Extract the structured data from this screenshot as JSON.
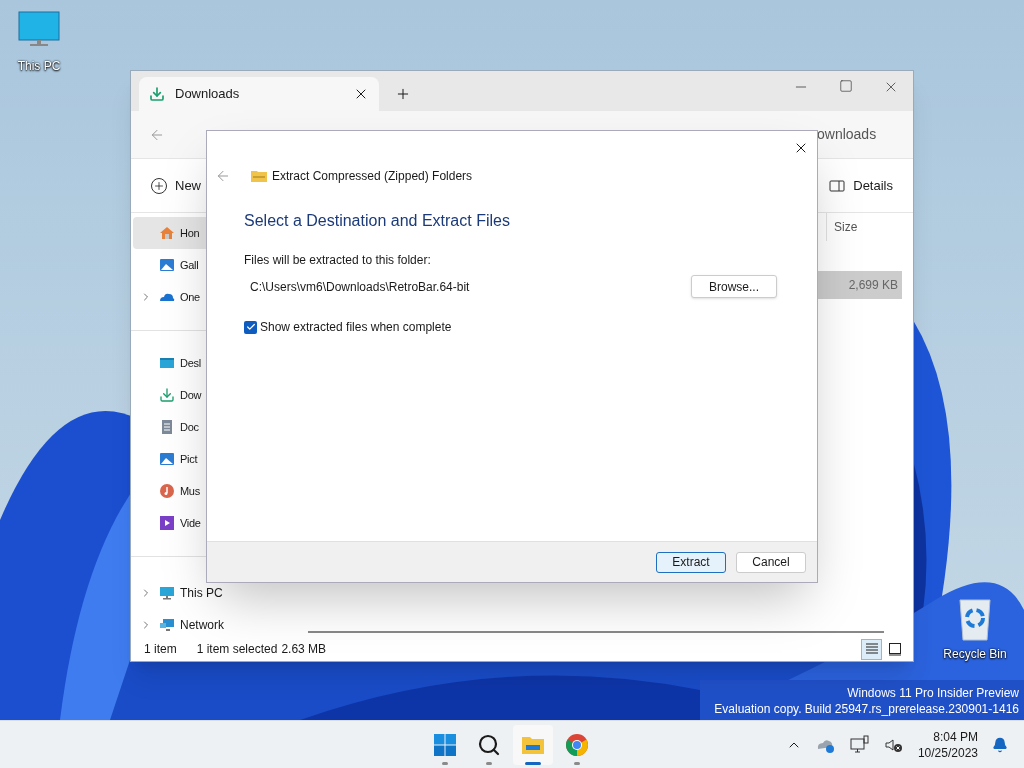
{
  "desktop_icons": [
    {
      "kind": "pc",
      "label": "This PC"
    },
    {
      "kind": "bin",
      "label": "Recycle Bin"
    }
  ],
  "explorer": {
    "tab": {
      "label": "Downloads",
      "selected": true
    },
    "search_field": {
      "placeholder": "ownloads"
    },
    "command_bar": {
      "new": "New",
      "details": "Details"
    },
    "sidebar": {
      "groups": [
        [
          {
            "kind": "home",
            "label": "Hon",
            "selected": true,
            "expandable": false
          },
          {
            "kind": "gallery",
            "label": "Gall",
            "selected": false,
            "expandable": false
          },
          {
            "kind": "cloud",
            "label": "One",
            "selected": false,
            "expandable": true
          }
        ],
        [
          {
            "kind": "desktop",
            "label": "Desl",
            "selected": false,
            "expandable": false
          },
          {
            "kind": "download",
            "label": "Dow",
            "selected": false,
            "expandable": false
          },
          {
            "kind": "document",
            "label": "Doc",
            "selected": false,
            "expandable": false
          },
          {
            "kind": "gallery",
            "label": "Pict",
            "selected": false,
            "expandable": false
          },
          {
            "kind": "music",
            "label": "Mus",
            "selected": false,
            "expandable": false
          },
          {
            "kind": "video",
            "label": "Vide",
            "selected": false,
            "expandable": false
          }
        ],
        [
          {
            "kind": "pc",
            "label": "This PC",
            "selected": false,
            "expandable": true
          },
          {
            "kind": "network",
            "label": "Network",
            "selected": false,
            "expandable": true
          }
        ]
      ]
    },
    "column": "Size",
    "row": {
      "size": "2,699 KB",
      "selected": true
    },
    "status_bar": {
      "count": "1 item",
      "selection": "1 item selected",
      "size": "2.63 MB"
    },
    "view_buttons": [
      {
        "kind": "details",
        "selected": true
      },
      {
        "kind": "tiles",
        "selected": false
      }
    ]
  },
  "dialog": {
    "title": "Extract Compressed (Zipped) Folders",
    "heading": "Select a Destination and Extract Files",
    "folder_label": "Files will be extracted to this folder:",
    "path": "C:\\Users\\vm6\\Downloads\\RetroBar.64-bit",
    "browse": "Browse...",
    "show_files": {
      "label": "Show extracted files when complete",
      "checked": true
    },
    "buttons": [
      {
        "label": "Extract",
        "default": true
      },
      {
        "label": "Cancel",
        "default": false
      }
    ]
  },
  "watermark": [
    "Windows 11 Pro Insider Preview",
    "Evaluation copy. Build 25947.rs_prerelease.230901-1416"
  ],
  "taskbar": {
    "apps": [
      {
        "kind": "start",
        "active": false
      },
      {
        "kind": "search",
        "active": false
      },
      {
        "kind": "explorer",
        "active": true
      },
      {
        "kind": "chrome",
        "active": false
      }
    ],
    "time": "8:04 PM",
    "date": "10/25/2023"
  }
}
